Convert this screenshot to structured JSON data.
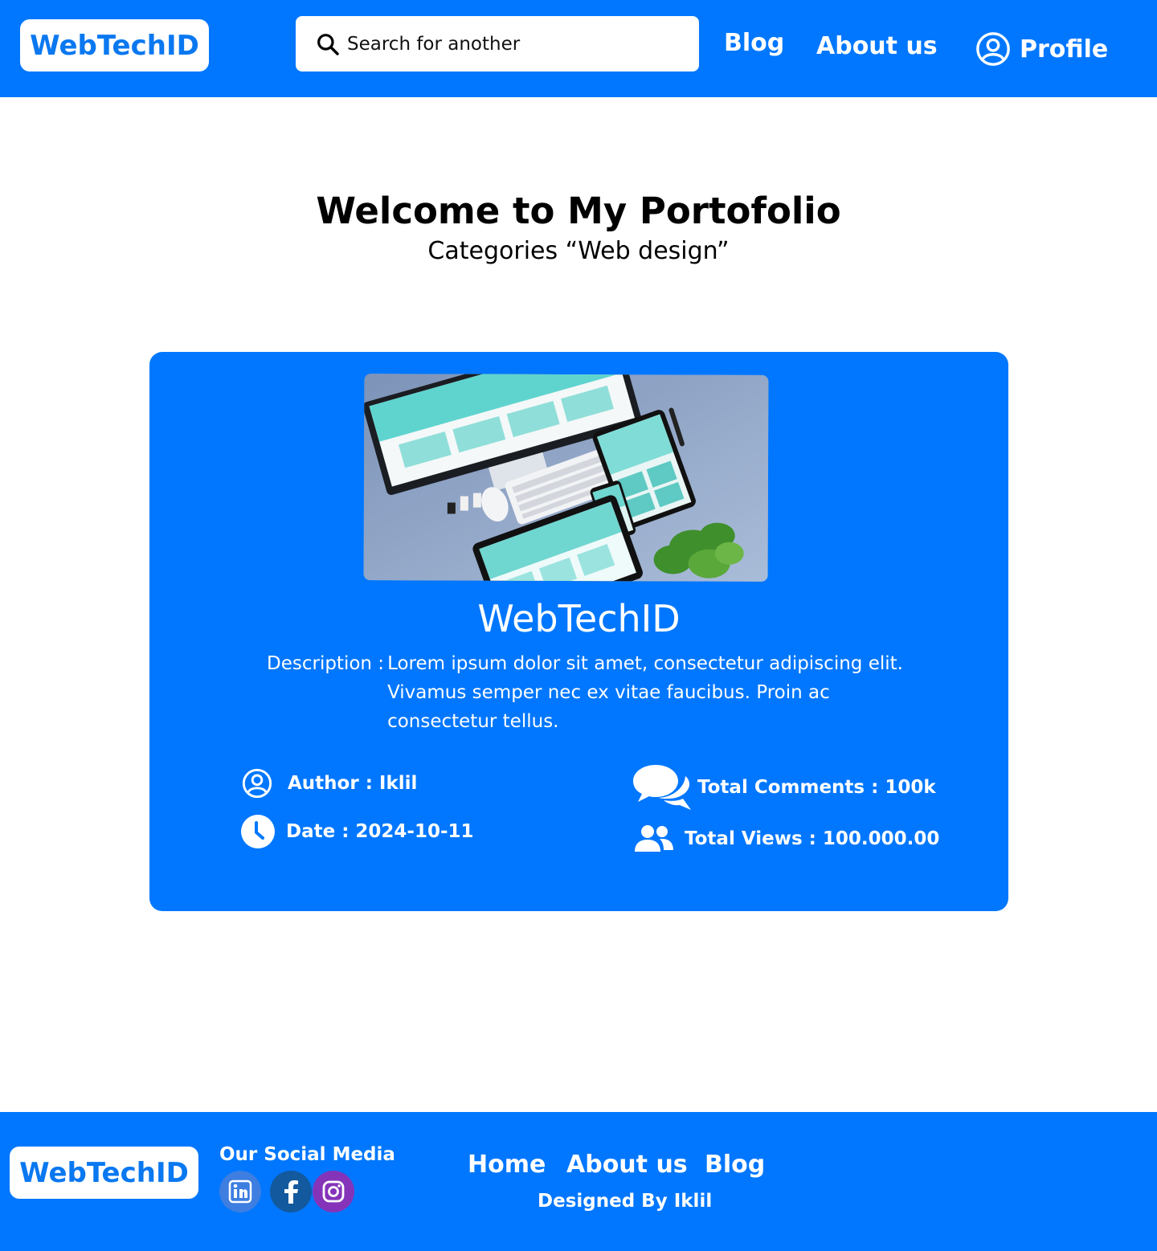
{
  "header": {
    "logo": "WebTechID",
    "search": {
      "placeholder": "Search for another",
      "icon": "search-icon"
    },
    "nav": {
      "blog": "Blog",
      "about": "About us",
      "profile": "Profile",
      "profile_icon": "user-circle-icon"
    }
  },
  "hero": {
    "title": "Welcome to My Portofolio",
    "subtitle": "Categories “Web design”"
  },
  "card": {
    "image_alt": "Responsive devices mockup",
    "title": "WebTechID",
    "description_label": "Description :",
    "description": "Lorem ipsum dolor sit amet, consectetur adipiscing elit. Vivamus semper nec ex vitae faucibus. Proin ac consectetur tellus.",
    "author": "Author : Iklil",
    "date": "Date : 2024-10-11",
    "comments": "Total Comments : 100k",
    "views": "Total Views : 100.000.00"
  },
  "footer": {
    "logo": "WebTechID",
    "social_title": "Our Social Media",
    "social": [
      "linkedin-icon",
      "facebook-icon",
      "instagram-icon"
    ],
    "nav": {
      "home": "Home",
      "about": "About us",
      "blog": "Blog"
    },
    "designed_by": "Designed By Iklil"
  },
  "colors": {
    "brand": "#0077fe",
    "logo_text": "#0a78f0",
    "background": "#ffffff"
  }
}
